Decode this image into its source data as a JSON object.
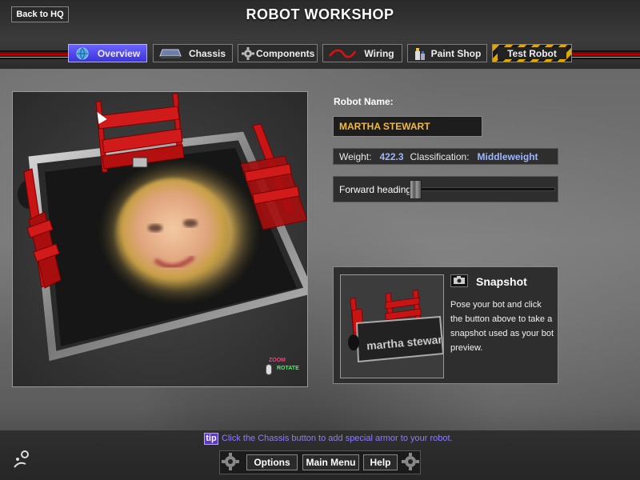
{
  "header": {
    "title": "ROBOT WORKSHOP",
    "back_label": "Back to HQ"
  },
  "tabs": [
    {
      "label": "Overview",
      "icon": "globe-icon",
      "active": true
    },
    {
      "label": "Chassis",
      "icon": "chassis-icon",
      "active": false
    },
    {
      "label": "Components",
      "icon": "gear-icon",
      "active": false
    },
    {
      "label": "Wiring",
      "icon": "wire-icon",
      "active": false
    },
    {
      "label": "Paint Shop",
      "icon": "paint-can-icon",
      "active": false
    },
    {
      "label": "Test Robot",
      "icon": "hazard-stripe",
      "active": false
    }
  ],
  "viewport": {
    "controls": {
      "zoom_label": "ZOOM",
      "rotate_label": "ROTATE"
    }
  },
  "robot": {
    "name_label": "Robot Name:",
    "name_value": "MARTHA STEWART",
    "weight_label": "Weight:",
    "weight_value": "422.3",
    "class_label": "Classification:",
    "class_value": "Middleweight",
    "heading_label": "Forward heading:"
  },
  "snapshot": {
    "title": "Snapshot",
    "description": "Pose your bot and click the button above to take a snapshot used as your bot preview.",
    "preview_text": "martha stewart"
  },
  "tip": {
    "badge": "tip",
    "text": "Click the Chassis button to add special armor to your robot."
  },
  "footer": {
    "options_label": "Options",
    "main_menu_label": "Main Menu",
    "help_label": "Help"
  },
  "colors": {
    "accent_tab": "#4b43e8",
    "name_text": "#f2b93b",
    "stat_value": "#9fb6ff",
    "tip_text": "#8c7cff",
    "armor_red": "#c81414"
  }
}
